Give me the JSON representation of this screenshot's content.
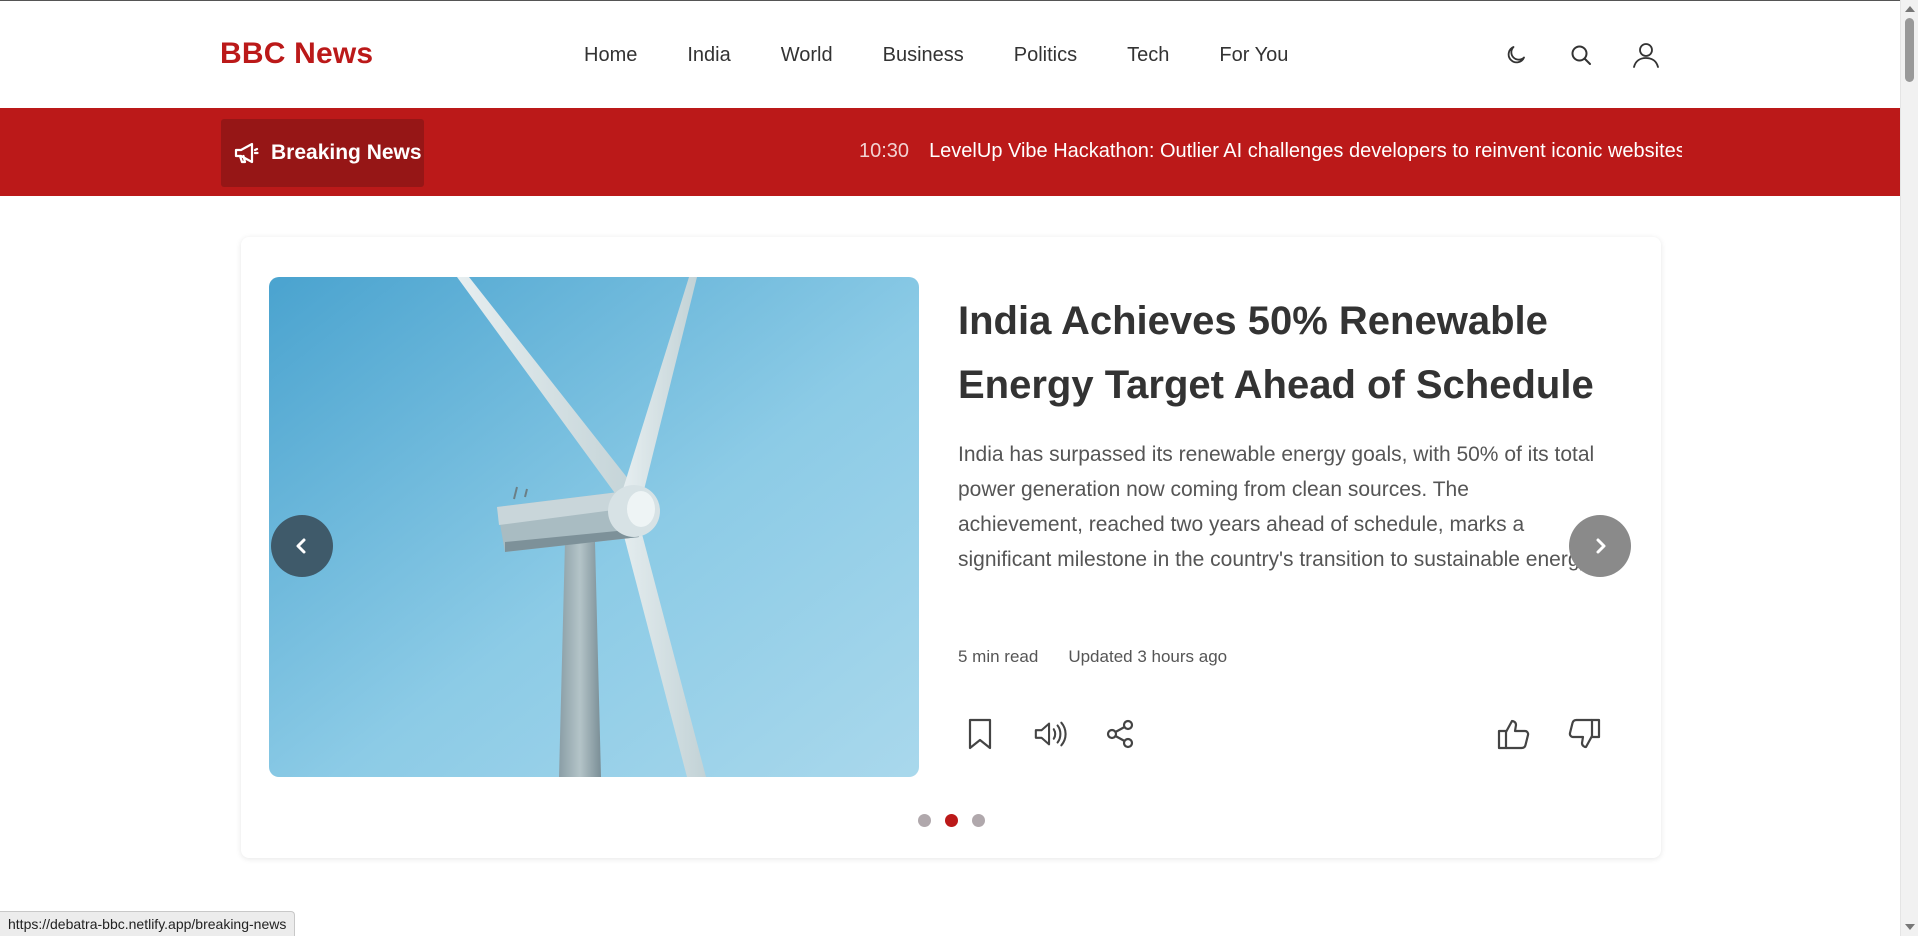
{
  "header": {
    "logo": "BBC News",
    "nav": [
      "Home",
      "India",
      "World",
      "Business",
      "Politics",
      "Tech",
      "For You"
    ],
    "icons": [
      "moon-icon",
      "search-icon",
      "user-icon"
    ]
  },
  "breaking": {
    "label": "Breaking News",
    "icon": "megaphone-icon",
    "time": "10:30",
    "headline": "LevelUp Vibe Hackathon: Outlier AI challenges developers to reinvent iconic websites"
  },
  "featured": {
    "image": "wind-turbine",
    "title": "India Achieves 50% Renewable Energy Target Ahead of Schedule",
    "summary": "India has surpassed its renewable energy goals, with 50% of its total power generation now coming from clean sources. The achievement, reached two years ahead of schedule, marks a significant milestone in the country's transition to sustainable energy.",
    "read_time": "5 min read",
    "updated": "Updated 3 hours ago",
    "actions_left": [
      "bookmark-icon",
      "speaker-icon",
      "share-icon"
    ],
    "actions_right": [
      "thumbs-up-icon",
      "thumbs-down-icon"
    ],
    "slide_count": 3,
    "active_slide": 2
  },
  "colors": {
    "brand": "#bb1919",
    "breaking_badge": "#961616",
    "dot_inactive": "#b0a8ac",
    "dot_active": "#bb1919"
  },
  "status_url": "https://debatra-bbc.netlify.app/breaking-news"
}
